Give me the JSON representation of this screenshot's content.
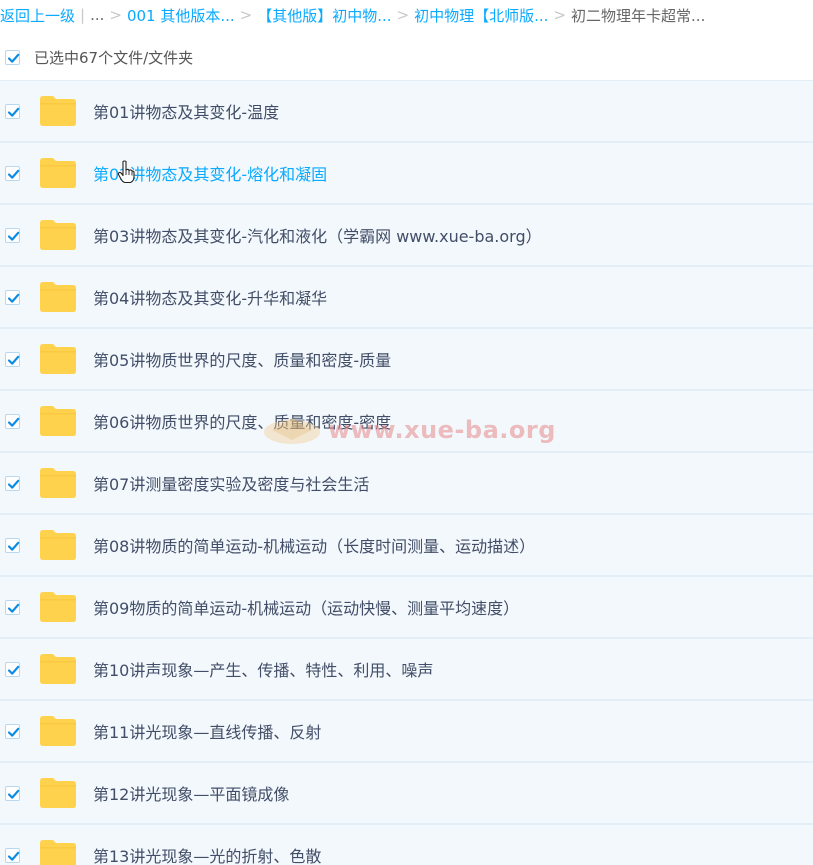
{
  "breadcrumb": {
    "back": "返回上一级",
    "sep_bar": "|",
    "ellipsis": "...",
    "arrow": ">",
    "crumb1": "001 其他版本...",
    "crumb2": "【其他版】初中物...",
    "crumb3": "初中物理【北师版...",
    "current": "初二物理年卡超常..."
  },
  "selection": {
    "label": "已选中67个文件/文件夹"
  },
  "files": [
    {
      "name": "第01讲物态及其变化-温度"
    },
    {
      "name": "第02讲物态及其变化-熔化和凝固"
    },
    {
      "name": "第03讲物态及其变化-汽化和液化（学霸网 www.xue-ba.org）"
    },
    {
      "name": "第04讲物态及其变化-升华和凝华"
    },
    {
      "name": "第05讲物质世界的尺度、质量和密度-质量"
    },
    {
      "name": "第06讲物质世界的尺度、质量和密度-密度"
    },
    {
      "name": "第07讲测量密度实验及密度与社会生活"
    },
    {
      "name": "第08讲物质的简单运动-机械运动（长度时间测量、运动描述）"
    },
    {
      "name": "第09物质的简单运动-机械运动（运动快慢、测量平均速度）"
    },
    {
      "name": "第10讲声现象—产生、传播、特性、利用、噪声"
    },
    {
      "name": "第11讲光现象—直线传播、反射"
    },
    {
      "name": "第12讲光现象—平面镜成像"
    },
    {
      "name": "第13讲光现象—光的折射、色散"
    }
  ],
  "watermark": {
    "text": "www.xue-ba.org"
  },
  "colors": {
    "accent": "#09aaff",
    "folder": "#ffd24d",
    "row_bg": "#f3f8fd",
    "check": "#0a8ce6"
  }
}
